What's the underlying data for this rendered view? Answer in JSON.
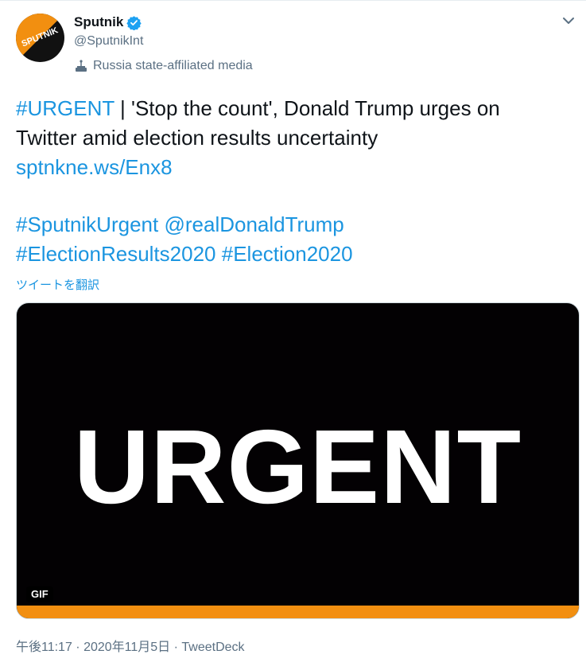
{
  "account": {
    "name": "Sputnik",
    "handle": "@SputnikInt",
    "label": "Russia state-affiliated media",
    "avatar_text": "SPUTNIK"
  },
  "tweet": {
    "hashtag_urgent": "#URGENT",
    "headline_rest_1": " | 'Stop the count', Donald Trump urges on",
    "headline_line_2": "Twitter amid election results uncertainty",
    "short_link": "sptnkne.ws/Enx8",
    "tag_sputnik_urgent": "#SputnikUrgent",
    "mention_trump": "@realDonaldTrump",
    "tag_election_results": "#ElectionResults2020",
    "tag_election": "#Election2020"
  },
  "translate_label": "ツイートを翻訳",
  "media": {
    "word": "URGENT",
    "badge": "GIF"
  },
  "meta": {
    "time": "午後11:17",
    "sep1": " · ",
    "date": "2020年11月5日",
    "sep2": " · ",
    "source": "TweetDeck"
  },
  "colors": {
    "link": "#1b95e0",
    "muted": "#5b7083",
    "verified": "#1da1f2",
    "media_accent": "#f28f10"
  },
  "icons": {
    "verified": "verified-badge-icon",
    "label": "podium-icon",
    "menu": "chevron-down-icon"
  }
}
